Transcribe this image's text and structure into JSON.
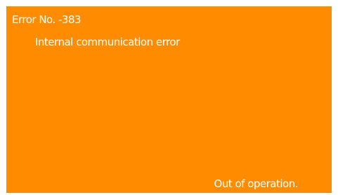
{
  "screen": {
    "background_color": "#ff8c00",
    "text_color": "#ffffff",
    "error_code": "Error No. -383",
    "error_message": "Internal communication error",
    "status": "Out of operation."
  }
}
